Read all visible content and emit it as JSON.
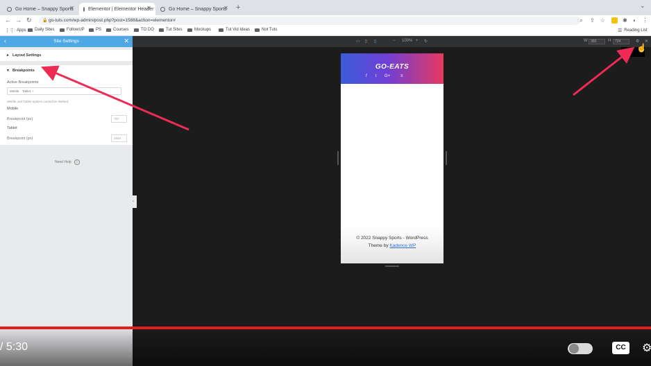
{
  "browser": {
    "tabs": [
      {
        "label": "Go Home – Snappy Sports",
        "active": false
      },
      {
        "label": "Elementor | Elementor Header",
        "active": true
      },
      {
        "label": "Go Home – Snappy Sports",
        "active": false
      }
    ],
    "new_tab": "+",
    "url": "go-tuts.com/wp-admin/post.php?post=1588&action=elementor#",
    "bookmarks": [
      "Apps",
      "Daily Sites",
      "FollowUP",
      "PS",
      "Courses",
      "TO DO",
      "Tut Sites",
      "Mockups",
      "Tut Vid Ideas",
      "Not Tuts"
    ],
    "reading_list": "Reading List"
  },
  "panel": {
    "title": "Site Settings",
    "layout_settings": "Layout Settings",
    "breakpoints": "Breakpoints",
    "active_breakpoints_label": "Active Breakpoints",
    "active_breakpoints_tags": [
      "Mobile",
      "Tablet"
    ],
    "hint": "Mobile and Tablet options cannot be deleted.",
    "mobile_label": "Mobile",
    "mobile_breakpoint_label": "Breakpoint (px)",
    "mobile_breakpoint_value": "767",
    "tablet_label": "Tablet",
    "tablet_breakpoint_label": "Breakpoint (px)",
    "tablet_breakpoint_value": "1024",
    "need_help": "Need Help"
  },
  "canvas_toolbar": {
    "zoom": "100%",
    "width_value": "360",
    "height_value": "724"
  },
  "preview": {
    "logo": "GO-EATS",
    "social": [
      "f",
      "t",
      "G+",
      "≡"
    ],
    "footer_line1": "© 2022 Snappy Sports - WordPress",
    "footer_line2_prefix": "Theme by ",
    "footer_link": "Kadence WP"
  },
  "video": {
    "time": "/ 5:30",
    "cc": "CC"
  },
  "colors": {
    "accent": "#e21f1f",
    "panel_header": "#4fa8e6",
    "arrow": "#ee2b55"
  }
}
